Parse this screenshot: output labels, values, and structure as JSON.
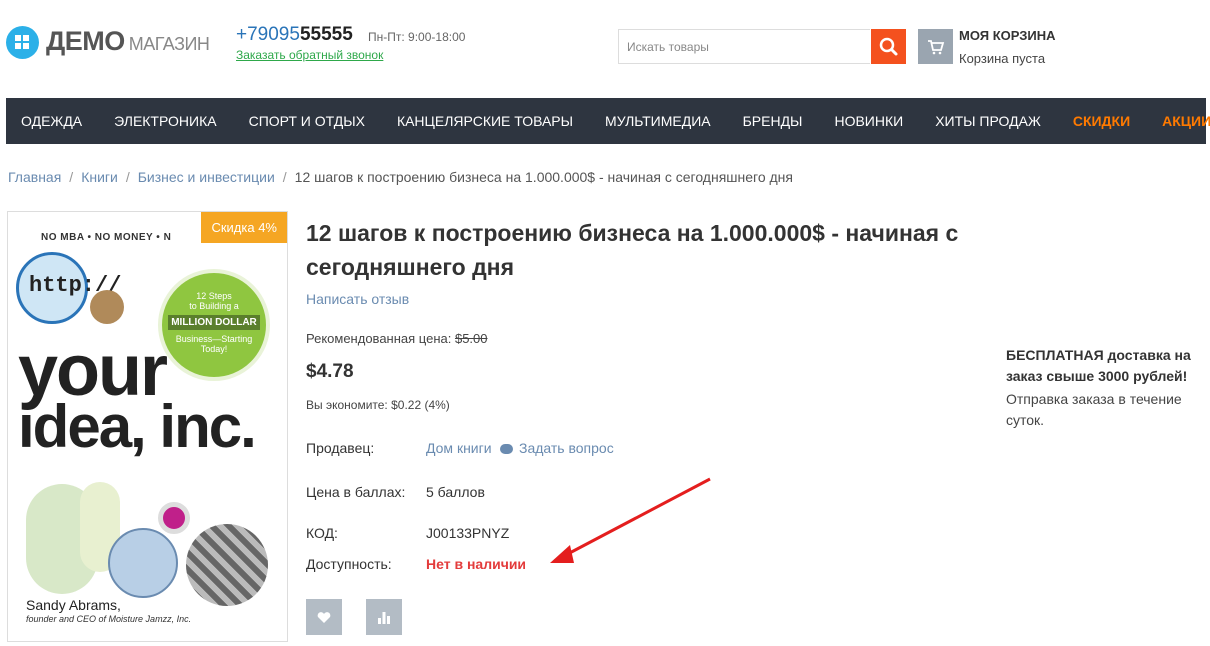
{
  "header": {
    "logo_main": "ДЕМО",
    "logo_sub": "МАГАЗИН",
    "phone_prefix": "+79095",
    "phone_bold": "55555",
    "hours": "Пн-Пт: 9:00-18:00",
    "callback": "Заказать обратный звонок",
    "search_placeholder": "Искать товары",
    "cart_title": "МОЯ КОРЗИНА",
    "cart_status": "Корзина пуста"
  },
  "nav": {
    "items": [
      "ОДЕЖДА",
      "ЭЛЕКТРОНИКА",
      "СПОРТ И ОТДЫХ",
      "КАНЦЕЛЯРСКИЕ ТОВАРЫ",
      "МУЛЬТИМЕДИА",
      "БРЕНДЫ",
      "НОВИНКИ",
      "ХИТЫ ПРОДАЖ"
    ],
    "highlight": [
      "СКИДКИ",
      "АКЦИИ"
    ]
  },
  "breadcrumb": {
    "items": [
      "Главная",
      "Книги",
      "Бизнес и инвестиции"
    ],
    "current": "12 шагов к построению бизнеса на 1.000.000$ - начиная с сегодняшнего дня",
    "separator": "/"
  },
  "product": {
    "discount_badge": "Скидка 4%",
    "title": "12 шагов к построению бизнеса на 1.000.000$ - начиная с сегодняшнего дня",
    "write_review": "Написать отзыв",
    "rec_label": "Рекомендованная цена:",
    "rec_price": "$5.00",
    "price": "$4.78",
    "savings": "Вы экономите: $0.22 (4%)",
    "seller_label": "Продавец:",
    "seller": "Дом книги",
    "ask_question": "Задать вопрос",
    "points_label": "Цена в баллах:",
    "points": "5 баллов",
    "code_label": "КОД:",
    "code": "J00133PNYZ",
    "availability_label": "Доступность:",
    "availability": "Нет в наличии"
  },
  "cover": {
    "top_text": "NO MBA • NO MONEY • N",
    "http": "http://",
    "circle_line1": "12 Steps",
    "circle_line2": "to Building a",
    "circle_line3": "MILLION DOLLAR",
    "circle_line4": "Business—Starting",
    "circle_line5": "Today!",
    "title1": "your",
    "title2": "idea, inc.",
    "author": "Sandy Abrams,",
    "author_sub": "founder and CEO of Moisture Jamzz, Inc."
  },
  "delivery": {
    "title": "БЕСПЛАТНАЯ доставка на заказ свыше 3000 рублей!",
    "note": "Отправка заказа в течение суток."
  },
  "colors": {
    "nav_bg": "#2e3540",
    "accent_orange": "#ff7a00",
    "search_button": "#f4511e",
    "badge": "#f5a623",
    "unavailable": "#e33b3b",
    "link": "#6a8bb0"
  }
}
